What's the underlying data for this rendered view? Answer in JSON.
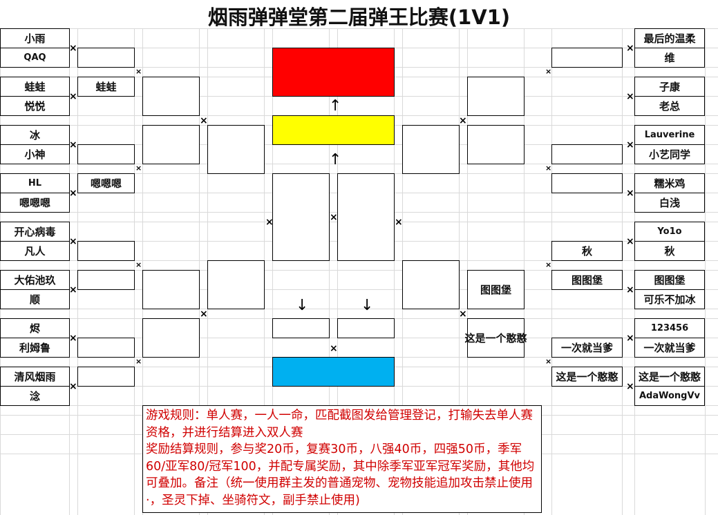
{
  "title": "烟雨弹弹堂第二届弹王比赛(1V1)",
  "left_players": [
    "小雨",
    "QAQ",
    "蛙蛙",
    "悦悦",
    "冰",
    "小神",
    "HL",
    "嗯嗯嗯",
    "开心病毒",
    "凡人",
    "大佑池玖",
    "顺",
    "烬",
    "利姆鲁",
    "清风烟雨",
    "淰"
  ],
  "right_players": [
    "最后的温柔",
    "维",
    "子康",
    "老总",
    "Lauverine",
    "小艺同学",
    "糯米鸡",
    "白浅",
    "Yo1o",
    "秋",
    "图图堡",
    "可乐不加冰",
    "123456",
    "一次就当爹",
    "这是一个憨憨",
    "AdaWongVv"
  ],
  "left_round2": {
    "r2": "蛙蛙",
    "r4": "嗯嗯嗯"
  },
  "right_round2": {
    "r5": "秋",
    "r6": "图图堡",
    "r7": "一次就当爹",
    "r8": "这是一个憨憨"
  },
  "right_round3": {
    "r3": "图图堡",
    "r4": "这是一个憨憨"
  },
  "colors": {
    "first": "#ff0000",
    "second": "#ffff00",
    "third": "#00b0f0",
    "rules_text": "#d00000"
  },
  "vs_mark": "×",
  "arrow_up": "↑",
  "arrow_down": "↓",
  "rules": [
    "游戏规则：单人赛，一人一命，匹配截图发给管理登记，打输失去单人赛资格，并进行结算进入双人赛",
    "奖励结算规则，参与奖20币，复赛30币，八强40币，四强50币，季军60/亚军80/冠军100，并配专属奖励，其中除季军亚军冠军奖励，其他均可叠加。备注（统一使用群主发的普通宠物、宠物技能追加攻击禁止使用·，圣灵下掉、坐骑符文，副手禁止使用)"
  ]
}
